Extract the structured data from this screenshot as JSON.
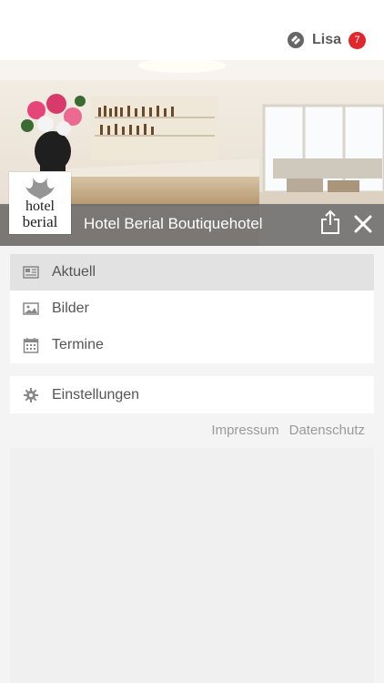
{
  "user": {
    "name": "Lisa",
    "badge_count": "7"
  },
  "hero": {
    "title": "Hotel Berial Boutiquehotel",
    "logo_line1": "hotel",
    "logo_line2": "berial"
  },
  "menu": {
    "items": [
      {
        "label": "Aktuell",
        "icon": "newspaper-icon",
        "active": true
      },
      {
        "label": "Bilder",
        "icon": "image-icon",
        "active": false
      },
      {
        "label": "Termine",
        "icon": "calendar-icon",
        "active": false
      }
    ],
    "settings": {
      "label": "Einstellungen",
      "icon": "gear-icon"
    }
  },
  "footer": {
    "impressum": "Impressum",
    "datenschutz": "Datenschutz"
  },
  "colors": {
    "badge": "#e0272b",
    "active_row": "#e2e2e2",
    "hero_bar": "#6e6e6e"
  }
}
